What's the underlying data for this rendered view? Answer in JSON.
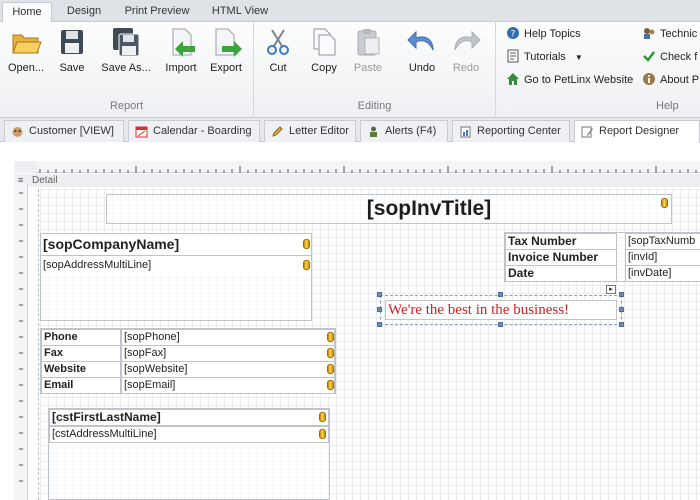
{
  "ribbon_tabs": [
    "Home",
    "Design",
    "Print Preview",
    "HTML View"
  ],
  "groups": {
    "report": {
      "label": "Report",
      "buttons": [
        "Open...",
        "Save",
        "Save As...",
        "Import",
        "Export"
      ]
    },
    "editing": {
      "label": "Editing",
      "buttons": [
        "Cut",
        "Copy",
        "Paste",
        "Undo",
        "Redo"
      ]
    },
    "help": {
      "label": "Help",
      "items": [
        "Help Topics",
        "Tutorials",
        "Go to PetLinx Website",
        "Technic",
        "Check f",
        "About P"
      ]
    }
  },
  "doc_tabs": [
    "Customer [VIEW]",
    "Calendar - Boarding",
    "Letter Editor",
    "Alerts (F4)",
    "Reporting Center",
    "Report Designer"
  ],
  "band": "Detail",
  "report": {
    "title": "[sopInvTitle]",
    "company_name": "[sopCompanyName]",
    "address": "[sopAddressMultiLine]",
    "contact_labels": [
      "Phone",
      "Fax",
      "Website",
      "Email"
    ],
    "contact_values": [
      "[sopPhone]",
      "[sopFax]",
      "[sopWebsite]",
      "[sopEmail]"
    ],
    "customer_name": "[cstFirstLastName]",
    "customer_address": "[cstAddressMultiLine]",
    "invoice_labels": [
      "Tax Number",
      "Invoice Number",
      "Date"
    ],
    "invoice_values": [
      "[sopTaxNumb",
      "[invId]",
      "[invDate]"
    ],
    "slogan": "We're the best in the business!"
  },
  "colors": {
    "slogan": "#d42020",
    "accent": "#2b6cb0"
  }
}
